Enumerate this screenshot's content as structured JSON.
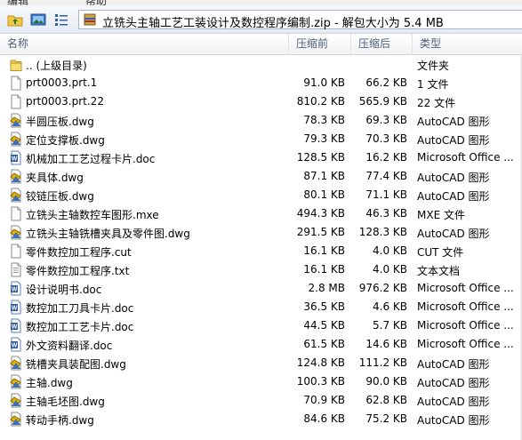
{
  "menubar": {
    "items": [
      "编辑",
      "帮助"
    ]
  },
  "toolbar": {
    "address_text": "立铣头主轴工艺工装设计及数控程序编制.zip - 解包大小为 5.4 MB",
    "buttons": [
      "folder-up",
      "view-details",
      "view-list"
    ]
  },
  "columns": {
    "name": "名称",
    "packed": "压缩前",
    "unpacked": "压缩后",
    "type": "类型"
  },
  "rows": [
    {
      "name": ".. (上级目录)",
      "packed": "",
      "unpacked": "",
      "type": "文件夹",
      "icon": "folder-icon"
    },
    {
      "name": "prt0003.prt.1",
      "packed": "91.0 KB",
      "unpacked": "66.2 KB",
      "type": "1 文件",
      "icon": "file-icon"
    },
    {
      "name": "prt0003.prt.22",
      "packed": "810.2 KB",
      "unpacked": "565.9 KB",
      "type": "22 文件",
      "icon": "file-icon"
    },
    {
      "name": "半圆压板.dwg",
      "packed": "78.3 KB",
      "unpacked": "69.3 KB",
      "type": "AutoCAD 图形",
      "icon": "dwg-icon"
    },
    {
      "name": "定位支撑板.dwg",
      "packed": "79.3 KB",
      "unpacked": "70.3 KB",
      "type": "AutoCAD 图形",
      "icon": "dwg-icon"
    },
    {
      "name": "机械加工工艺过程卡片.doc",
      "packed": "128.5 KB",
      "unpacked": "16.2 KB",
      "type": "Microsoft Office ...",
      "icon": "doc-icon"
    },
    {
      "name": "夹具体.dwg",
      "packed": "87.1 KB",
      "unpacked": "77.4 KB",
      "type": "AutoCAD 图形",
      "icon": "dwg-icon"
    },
    {
      "name": "铰链压板.dwg",
      "packed": "80.1 KB",
      "unpacked": "71.1 KB",
      "type": "AutoCAD 图形",
      "icon": "dwg-icon"
    },
    {
      "name": "立铣头主轴数控车图形.mxe",
      "packed": "494.3 KB",
      "unpacked": "46.3 KB",
      "type": "MXE 文件",
      "icon": "file-icon"
    },
    {
      "name": "立铣头主轴铣槽夹具及零件图.dwg",
      "packed": "291.5 KB",
      "unpacked": "128.3 KB",
      "type": "AutoCAD 图形",
      "icon": "dwg-icon"
    },
    {
      "name": "零件数控加工程序.cut",
      "packed": "16.1 KB",
      "unpacked": "4.0 KB",
      "type": "CUT 文件",
      "icon": "file-icon"
    },
    {
      "name": "零件数控加工程序.txt",
      "packed": "16.1 KB",
      "unpacked": "4.0 KB",
      "type": "文本文档",
      "icon": "txt-icon"
    },
    {
      "name": "设计说明书.doc",
      "packed": "2.8 MB",
      "unpacked": "976.2 KB",
      "type": "Microsoft Office ...",
      "icon": "doc-icon"
    },
    {
      "name": "数控加工刀具卡片.doc",
      "packed": "36.5 KB",
      "unpacked": "4.6 KB",
      "type": "Microsoft Office ...",
      "icon": "doc-icon"
    },
    {
      "name": "数控加工工艺卡片.doc",
      "packed": "44.5 KB",
      "unpacked": "5.7 KB",
      "type": "Microsoft Office ...",
      "icon": "doc-icon"
    },
    {
      "name": "外文资料翻译.doc",
      "packed": "61.5 KB",
      "unpacked": "14.6 KB",
      "type": "Microsoft Office ...",
      "icon": "doc-icon"
    },
    {
      "name": "铣槽夹具装配图.dwg",
      "packed": "124.8 KB",
      "unpacked": "111.2 KB",
      "type": "AutoCAD 图形",
      "icon": "dwg-icon"
    },
    {
      "name": "主轴.dwg",
      "packed": "100.3 KB",
      "unpacked": "90.0 KB",
      "type": "AutoCAD 图形",
      "icon": "dwg-icon"
    },
    {
      "name": "主轴毛坯图.dwg",
      "packed": "70.9 KB",
      "unpacked": "62.8 KB",
      "type": "AutoCAD 图形",
      "icon": "dwg-icon"
    },
    {
      "name": "转动手柄.dwg",
      "packed": "84.6 KB",
      "unpacked": "75.2 KB",
      "type": "AutoCAD 图形",
      "icon": "dwg-icon"
    }
  ]
}
